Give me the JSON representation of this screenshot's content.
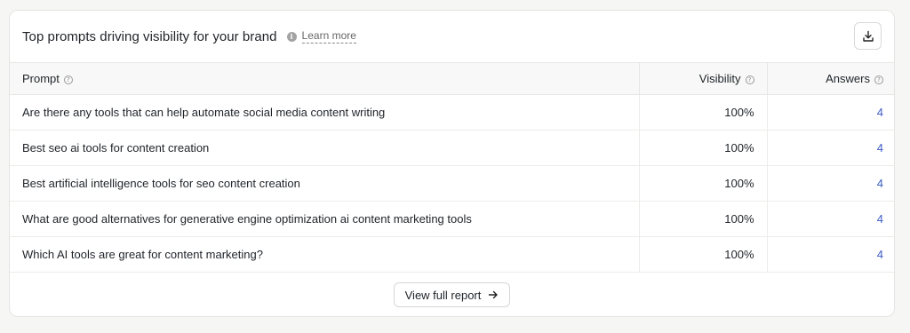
{
  "card": {
    "title": "Top prompts driving visibility for your brand",
    "info_glyph": "i",
    "learn_more": "Learn more"
  },
  "table": {
    "headers": {
      "prompt": "Prompt",
      "visibility": "Visibility",
      "answers": "Answers"
    },
    "rows": [
      {
        "prompt": "Are there any tools that can help automate social media content writing",
        "visibility": "100%",
        "answers": "4"
      },
      {
        "prompt": "Best seo ai tools for content creation",
        "visibility": "100%",
        "answers": "4"
      },
      {
        "prompt": "Best artificial intelligence tools for seo content creation",
        "visibility": "100%",
        "answers": "4"
      },
      {
        "prompt": "What are good alternatives for generative engine optimization ai content marketing tools",
        "visibility": "100%",
        "answers": "4"
      },
      {
        "prompt": "Which AI tools are great for content marketing?",
        "visibility": "100%",
        "answers": "4"
      }
    ]
  },
  "footer": {
    "button_label": "View full report"
  },
  "colors": {
    "link": "#3b5bc4",
    "header_bg": "#f7f8f7",
    "border": "#e7e7e5"
  },
  "icons": {
    "download": "download-icon",
    "help": "question-icon",
    "info": "info-icon",
    "arrow": "arrow-right-icon"
  }
}
